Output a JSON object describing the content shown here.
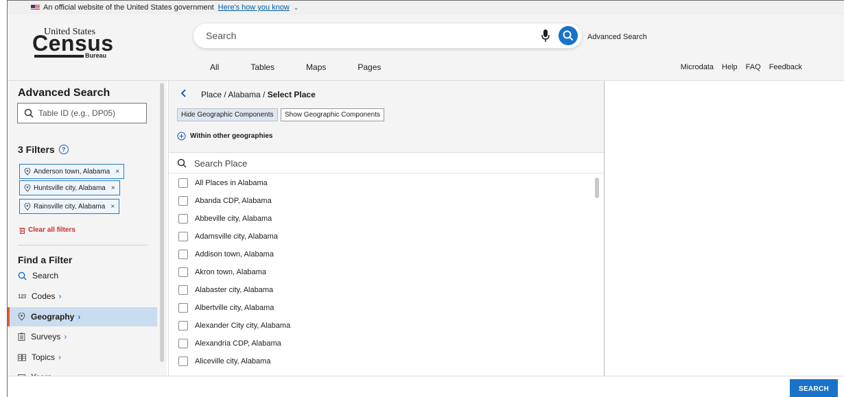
{
  "gov_banner": {
    "text": "An official website of the United States government",
    "link": "Here's how you know"
  },
  "logo": {
    "line1": "United States",
    "line2": "Census",
    "line3": "Bureau"
  },
  "header": {
    "search_placeholder": "Search",
    "advanced_search": "Advanced Search",
    "tabs": [
      "All",
      "Tables",
      "Maps",
      "Pages"
    ],
    "utility_links": [
      "Microdata",
      "Help",
      "FAQ",
      "Feedback"
    ]
  },
  "sidebar": {
    "title": "Advanced Search",
    "table_id_placeholder": "Table ID (e.g., DP05)",
    "filters_title": "3 Filters",
    "filters": [
      "Anderson town, Alabama",
      "Huntsville city, Alabama",
      "Rainsville city, Alabama"
    ],
    "clear_all": "Clear all filters",
    "find_title": "Find a Filter",
    "find_items": [
      {
        "label": "Search",
        "icon": "search-icon"
      },
      {
        "label": "Codes",
        "icon": "codes-icon"
      },
      {
        "label": "Geography",
        "icon": "location-pin-icon",
        "active": true
      },
      {
        "label": "Surveys",
        "icon": "clipboard-icon"
      },
      {
        "label": "Topics",
        "icon": "book-icon"
      },
      {
        "label": "Years",
        "icon": "calendar-icon"
      }
    ]
  },
  "main": {
    "breadcrumb_prefix": "Place / Alabama / ",
    "breadcrumb_current": "Select Place",
    "hide_btn": "Hide Geographic Components",
    "show_btn": "Show Geographic Components",
    "within_label": "Within other geographies",
    "search_placeholder": "Search Place",
    "places": [
      "All Places in Alabama",
      "Abanda CDP, Alabama",
      "Abbeville city, Alabama",
      "Adamsville city, Alabama",
      "Addison town, Alabama",
      "Akron town, Alabama",
      "Alabaster city, Alabama",
      "Albertville city, Alabama",
      "Alexander City city, Alabama",
      "Alexandria CDP, Alabama",
      "Aliceville city, Alabama"
    ]
  },
  "footer": {
    "search_button": "SEARCH"
  },
  "colors": {
    "accent": "#1a73c9",
    "active_bar": "#e25b2a",
    "danger": "#c5312e"
  }
}
